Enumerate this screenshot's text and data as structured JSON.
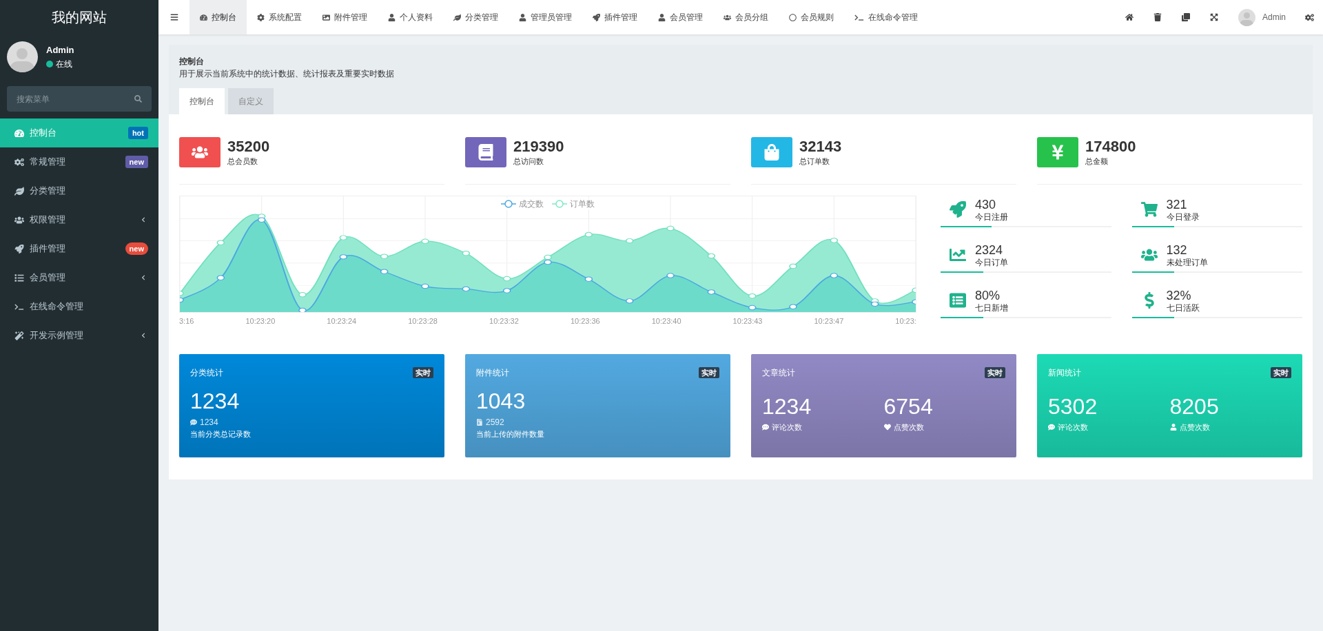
{
  "brand": "我的网站",
  "user": {
    "name": "Admin",
    "status": "在线"
  },
  "search": {
    "placeholder": "搜索菜单"
  },
  "sidebar": {
    "items": [
      {
        "label": "控制台",
        "selected": true,
        "collapsible": false,
        "badge": {
          "text": "hot",
          "color": "#0073b7"
        }
      },
      {
        "label": "常规管理",
        "selected": false,
        "collapsible": false,
        "badge": {
          "text": "new",
          "color": "#605ca8"
        }
      },
      {
        "label": "分类管理",
        "selected": false,
        "collapsible": false
      },
      {
        "label": "权限管理",
        "selected": false,
        "collapsible": true
      },
      {
        "label": "插件管理",
        "selected": false,
        "collapsible": false,
        "badge": {
          "text": "new",
          "color": "#e74c3c"
        }
      },
      {
        "label": "会员管理",
        "selected": false,
        "collapsible": true
      },
      {
        "label": "在线命令管理",
        "selected": false,
        "collapsible": false
      },
      {
        "label": "开发示例管理",
        "selected": false,
        "collapsible": true
      }
    ]
  },
  "topnav": {
    "tabs": [
      {
        "label": "控制台",
        "selected": true
      },
      {
        "label": "系统配置",
        "selected": false
      },
      {
        "label": "附件管理",
        "selected": false
      },
      {
        "label": "个人资料",
        "selected": false
      },
      {
        "label": "分类管理",
        "selected": false
      },
      {
        "label": "管理员管理",
        "selected": false
      },
      {
        "label": "插件管理",
        "selected": false
      },
      {
        "label": "会员管理",
        "selected": false
      },
      {
        "label": "会员分组",
        "selected": false
      },
      {
        "label": "会员规则",
        "selected": false
      },
      {
        "label": "在线命令管理",
        "selected": false
      }
    ],
    "user_name": "Admin"
  },
  "page": {
    "title": "控制台",
    "description": "用于展示当前系统中的统计数据、统计报表及重要实时数据",
    "tabs": [
      {
        "label": "控制台",
        "selected": true
      },
      {
        "label": "自定义",
        "selected": false
      }
    ]
  },
  "stats": [
    {
      "value": "35200",
      "label": "总会员数",
      "color": "#f05050"
    },
    {
      "value": "219390",
      "label": "总访问数",
      "color": "#7266ba"
    },
    {
      "value": "32143",
      "label": "总订单数",
      "color": "#23b7e5"
    },
    {
      "value": "174800",
      "label": "总金额",
      "color": "#27c24c"
    }
  ],
  "chart": {
    "legend": [
      {
        "label": "成交数",
        "color": "#4aa8e0"
      },
      {
        "label": "订单数",
        "color": "#7ee8c8"
      }
    ],
    "x_labels": [
      "3:16",
      "10:23:20",
      "10:23:24",
      "10:23:28",
      "10:23:32",
      "10:23:36",
      "10:23:40",
      "10:23:43",
      "10:23:47",
      "10:23:"
    ]
  },
  "mini_stats": [
    {
      "value": "430",
      "label": "今日注册",
      "level": 0.3
    },
    {
      "value": "321",
      "label": "今日登录",
      "level": 0.25
    },
    {
      "value": "2324",
      "label": "今日订单",
      "level": 0.25
    },
    {
      "value": "132",
      "label": "未处理订单",
      "level": 0.25
    },
    {
      "value": "80%",
      "label": "七日新增",
      "level": 0.25
    },
    {
      "value": "32%",
      "label": "七日活跃",
      "level": 0.25
    }
  ],
  "panels": [
    {
      "kind": "single",
      "title": "分类统计",
      "badge": "实时",
      "color": "#0088d9",
      "value": "1234",
      "sub": "1234",
      "note": "当前分类总记录数"
    },
    {
      "kind": "single",
      "title": "附件统计",
      "badge": "实时",
      "color": "#52a9e0",
      "value": "1043",
      "sub": "2592",
      "note": "当前上传的附件数量"
    },
    {
      "kind": "double",
      "title": "文章统计",
      "badge": "实时",
      "color": "#9189c4",
      "metrics": [
        {
          "value": "1234",
          "label": "评论次数"
        },
        {
          "value": "6754",
          "label": "点赞次数"
        }
      ]
    },
    {
      "kind": "double",
      "title": "新闻统计",
      "badge": "实时",
      "color": "#1cdab5",
      "metrics": [
        {
          "value": "5302",
          "label": "评论次数"
        },
        {
          "value": "8205",
          "label": "点赞次数"
        }
      ]
    }
  ]
}
